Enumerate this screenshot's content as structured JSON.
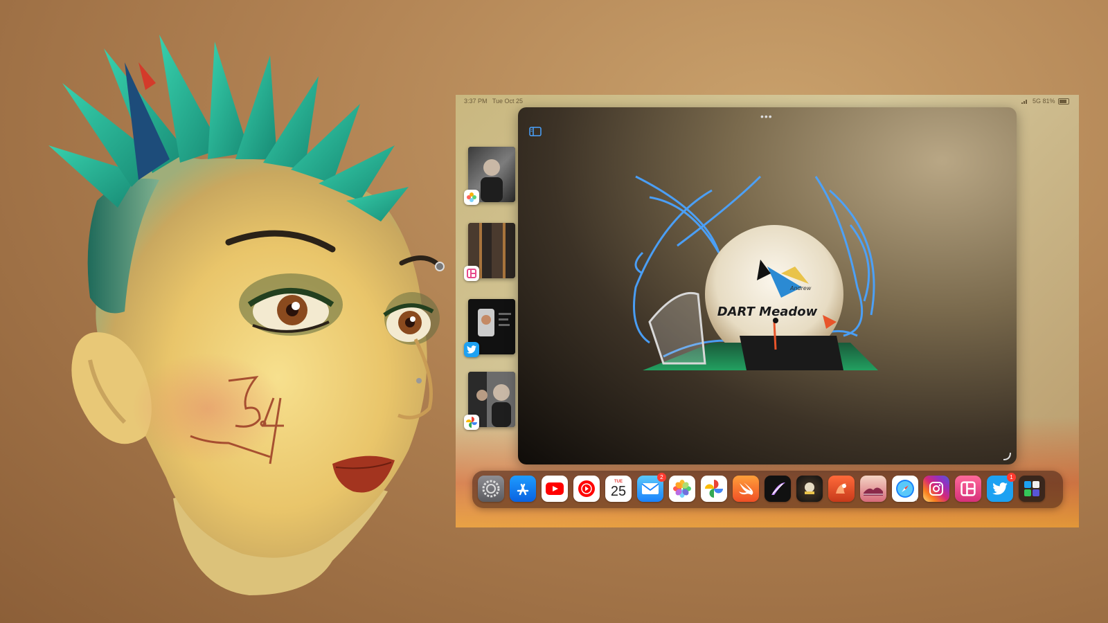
{
  "status_bar": {
    "time": "3:37 PM",
    "date": "Tue Oct 25",
    "network": "5G",
    "battery": "81%"
  },
  "stage_manager": {
    "items": [
      {
        "app": "Photos",
        "icon": "photos-icon"
      },
      {
        "app": "Layout",
        "icon": "layout-icon"
      },
      {
        "app": "Twitter",
        "icon": "twitter-icon"
      },
      {
        "app": "Google Photos",
        "icon": "google-photos-icon"
      }
    ]
  },
  "main_window": {
    "dots": "•••",
    "game_title": "DART Meadow",
    "game_subtitle": "Andrew"
  },
  "dock": {
    "calendar_day": "TUE",
    "calendar_date": "25",
    "mail_badge": "2",
    "twitter_badge": "1",
    "icons": [
      "settings-icon",
      "app-store-icon",
      "youtube-icon",
      "youtube-music-icon",
      "calendar-icon",
      "mail-icon",
      "photos-icon",
      "google-photos-icon",
      "swift-playgrounds-icon",
      "vectornator-icon",
      "game-icon",
      "fabric-icon",
      "landscape-icon",
      "safari-icon",
      "instagram-icon",
      "layout-icon",
      "twitter-icon",
      "app-library-icon"
    ]
  },
  "colors": {
    "background": "#b08152",
    "hair": "#2fb89c",
    "skin": "#f0d27a",
    "accent_blue": "#4aa3ff"
  }
}
